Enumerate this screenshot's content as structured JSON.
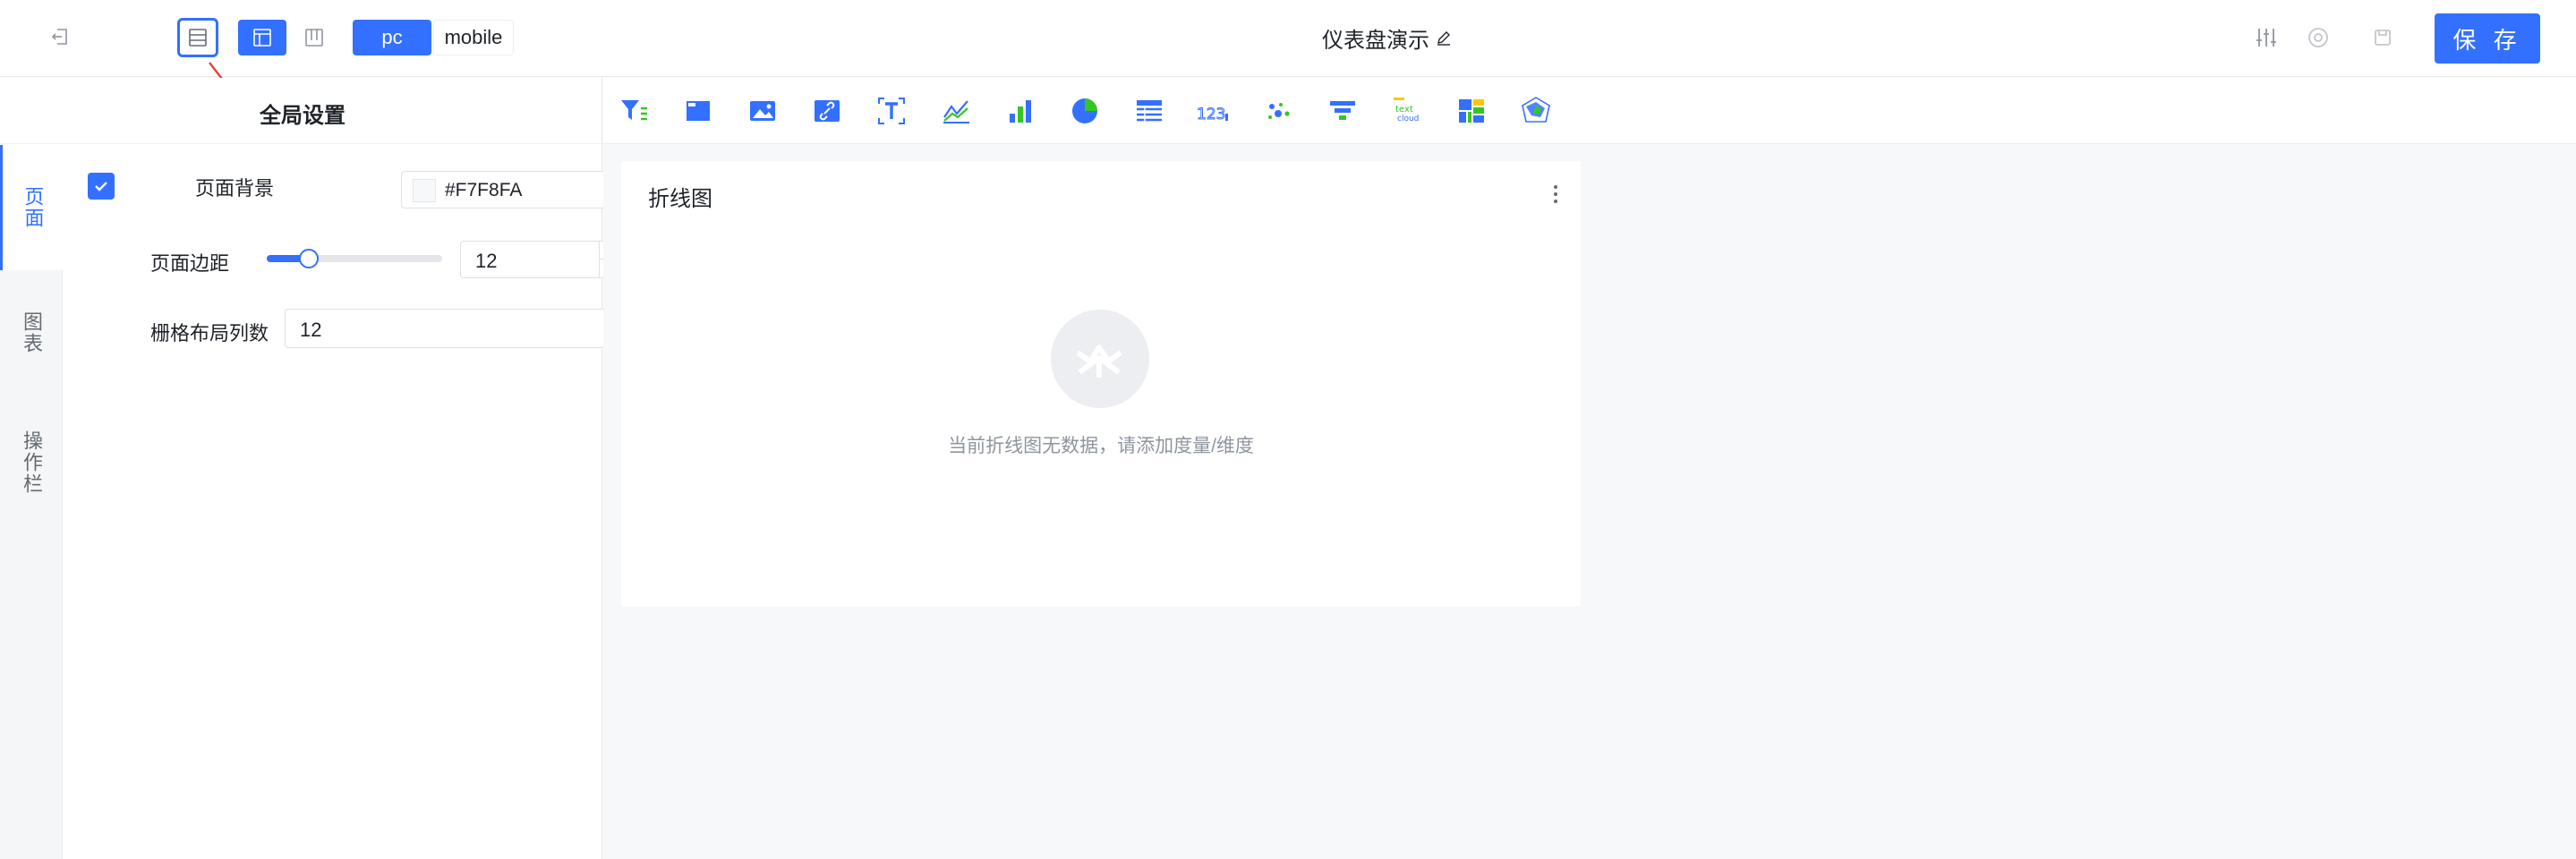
{
  "header": {
    "title": "仪表盘演示",
    "device_pc": "pc",
    "device_mobile": "mobile",
    "save_label": "保 存"
  },
  "left_panel": {
    "title": "全局设置",
    "tabs": [
      {
        "label": "页面",
        "active": true
      },
      {
        "label": "图表",
        "active": false
      },
      {
        "label": "操作栏",
        "active": false
      }
    ],
    "page_background": {
      "label": "页面背景",
      "checked": true,
      "color": "#F7F8FA"
    },
    "page_margin": {
      "label": "页面边距",
      "value": "12",
      "slider_fraction": 0.24
    },
    "grid_columns": {
      "label": "栅格布局列数",
      "value": "12"
    }
  },
  "toolbar": {
    "chart_types": [
      "filter-icon",
      "tab-container-icon",
      "image-icon",
      "link-icon",
      "text-icon",
      "line-chart-icon",
      "bar-chart-icon",
      "pie-chart-icon",
      "table-icon",
      "indicator-card-icon",
      "scatter-chart-icon",
      "funnel-chart-icon",
      "word-cloud-icon",
      "heatmap-icon",
      "radar-chart-icon"
    ],
    "word_cloud_text": "text cloud",
    "indicator_text": "123"
  },
  "canvas": {
    "card_title": "折线图",
    "empty_message": "当前折线图无数据，请添加度量/维度"
  },
  "colors": {
    "primary": "#3370FF",
    "canvas_bg": "#F7F8FA"
  }
}
